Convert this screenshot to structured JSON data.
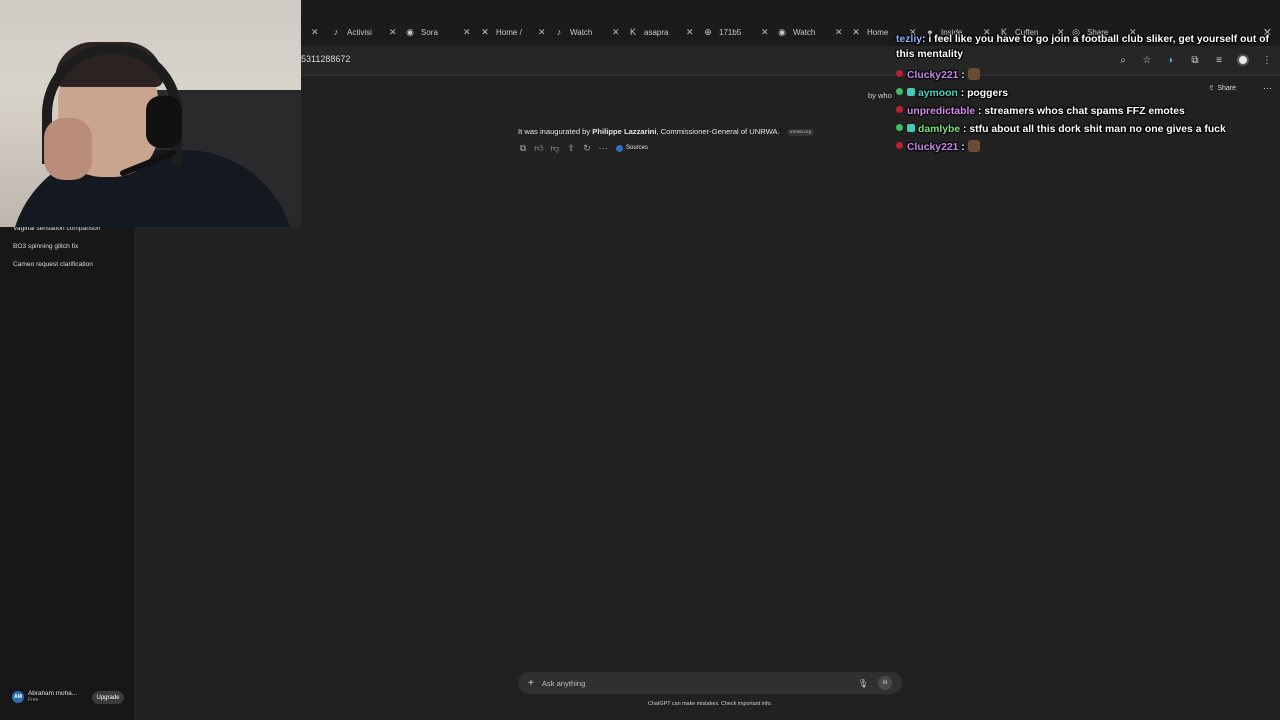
{
  "browser": {
    "tabs": [
      {
        "icon": "tiktok-icon",
        "glyph": "♪",
        "label": "Activisi"
      },
      {
        "icon": "sora-icon",
        "glyph": "◉",
        "label": "Sora"
      },
      {
        "icon": "x-icon",
        "glyph": "✕",
        "label": "Home /"
      },
      {
        "icon": "tiktok-icon",
        "glyph": "♪",
        "label": "Watch"
      },
      {
        "icon": "kick-icon",
        "glyph": "K",
        "label": "asapra"
      },
      {
        "icon": "globe-icon",
        "glyph": "⊕",
        "label": "171b5"
      },
      {
        "icon": "sora-icon",
        "glyph": "◉",
        "label": "Watch"
      },
      {
        "icon": "x-icon",
        "glyph": "✕",
        "label": "Home"
      },
      {
        "icon": "record-icon",
        "glyph": "●",
        "label": "Inside"
      },
      {
        "icon": "kick-icon",
        "glyph": "K",
        "label": "Cuffen"
      },
      {
        "icon": "chatgpt-icon",
        "glyph": "◎",
        "label": "Share"
      }
    ],
    "url": "5311288672"
  },
  "sidebar": {
    "items": [
      "Vaginal sensation comparison",
      "BO3 spinning glitch fix",
      "Cameo request clarification"
    ],
    "user": {
      "initials": "AM",
      "name": "Abraham moha...",
      "plan": "Free"
    },
    "upgrade_label": "Upgrade"
  },
  "header": {
    "share_label": "Share",
    "user_prompt_fragment": "by who"
  },
  "message": {
    "prefix": "It was inaugurated by ",
    "person": "Philippe Lazzarini",
    "suffix": ", Commissioner-General of UNRWA.",
    "source_chip": "unrwa.org",
    "sources_label": "Sources"
  },
  "composer": {
    "placeholder": "Ask anything"
  },
  "disclaimer": "ChatGPT can make mistakes. Check important info.",
  "chat": {
    "lines": [
      {
        "user": "tezliy",
        "color": "#8ab4f8",
        "message": ": i feel like you have to go join a football club sliker, get yourself out of",
        "continuation": "this mentality"
      },
      {
        "user": "Clucky221",
        "color": "#c586e8",
        "message": " :",
        "emote": true
      },
      {
        "user": "aymoon",
        "color": "#3fd9c4",
        "message": " : poggers"
      },
      {
        "user": "unpredictable",
        "color": "#d58cf0",
        "message": " : streamers whos chat spams FFZ emotes"
      },
      {
        "user": "damlybe",
        "color": "#7ee07e",
        "message": " : stfu about all this dork shit man no one gives a fuck"
      },
      {
        "user": "Clucky221",
        "color": "#c586e8",
        "message": " :",
        "emote": true
      }
    ]
  }
}
